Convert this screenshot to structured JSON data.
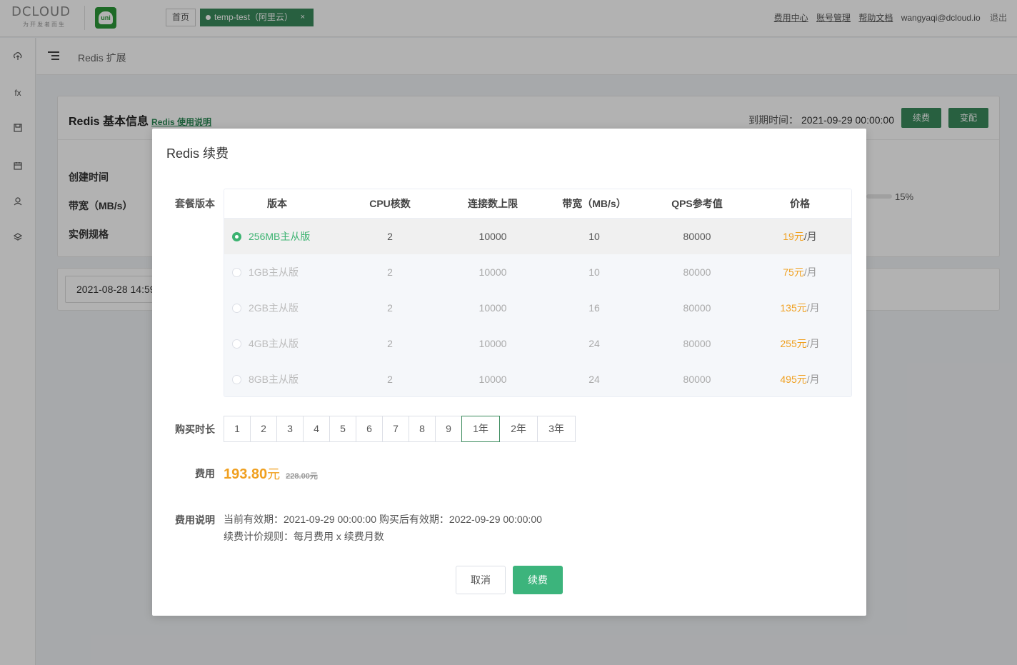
{
  "topbar": {
    "logo_text": "DCLOUD",
    "logo_tagline": "为开发者而生",
    "uni_logo_text": "uni",
    "tab_home": "首页",
    "tab_active": "temp-test（阿里云）",
    "tab_close": "×",
    "links": [
      "费用中心",
      "账号管理",
      "帮助文档"
    ],
    "user_email": "wangyaqi@dcloud.io",
    "logout": "退出"
  },
  "sidebar": {
    "icons": [
      "cloud-upload-icon",
      "function-icon",
      "storage-icon",
      "calendar-icon",
      "user-icon",
      "database-icon"
    ],
    "fx_label": "fx"
  },
  "header": {
    "breadcrumb": "Redis 扩展"
  },
  "card": {
    "title": "Redis 基本信息",
    "help_link": "Redis 使用说明",
    "expire_label": "到期时间：",
    "expire_value": "2021-09-29 00:00:00",
    "renew_button": "续费",
    "change_button": "变配",
    "labels": {
      "created": "创建时间",
      "bandwidth": "带宽（MB/s）",
      "spec": "实例规格"
    },
    "usage_percent": "15%",
    "date_value": "2021-08-28 14:59"
  },
  "modal": {
    "title": "Redis 续费",
    "plan_label": "套餐版本",
    "columns": [
      "版本",
      "CPU核数",
      "连接数上限",
      "带宽（MB/s）",
      "QPS参考值",
      "价格"
    ],
    "plans": [
      {
        "name": "256MB主从版",
        "cpu": "2",
        "conn": "10000",
        "bw": "10",
        "qps": "80000",
        "price": "19",
        "unit": "元",
        "per": "/月",
        "selected": true
      },
      {
        "name": "1GB主从版",
        "cpu": "2",
        "conn": "10000",
        "bw": "10",
        "qps": "80000",
        "price": "75",
        "unit": "元",
        "per": "/月",
        "selected": false
      },
      {
        "name": "2GB主从版",
        "cpu": "2",
        "conn": "10000",
        "bw": "16",
        "qps": "80000",
        "price": "135",
        "unit": "元",
        "per": "/月",
        "selected": false
      },
      {
        "name": "4GB主从版",
        "cpu": "2",
        "conn": "10000",
        "bw": "24",
        "qps": "80000",
        "price": "255",
        "unit": "元",
        "per": "/月",
        "selected": false
      },
      {
        "name": "8GB主从版",
        "cpu": "2",
        "conn": "10000",
        "bw": "24",
        "qps": "80000",
        "price": "495",
        "unit": "元",
        "per": "/月",
        "selected": false
      }
    ],
    "duration_label": "购买时长",
    "durations": [
      "1",
      "2",
      "3",
      "4",
      "5",
      "6",
      "7",
      "8",
      "9",
      "1年",
      "2年",
      "3年"
    ],
    "duration_selected": "1年",
    "fee_label": "费用",
    "fee_now": "193.80",
    "fee_unit": "元",
    "fee_old": "228.00元",
    "desc_label": "费用说明",
    "desc_line1": "当前有效期：2021-09-29 00:00:00 购买后有效期：2022-09-29 00:00:00",
    "desc_line2": "续费计价规则：每月费用 x 续费月数",
    "cancel": "取消",
    "confirm": "续费"
  },
  "colors": {
    "brand_green": "#3a8a5c",
    "confirm_green": "#3cb47c",
    "price_orange": "#f0a020"
  }
}
